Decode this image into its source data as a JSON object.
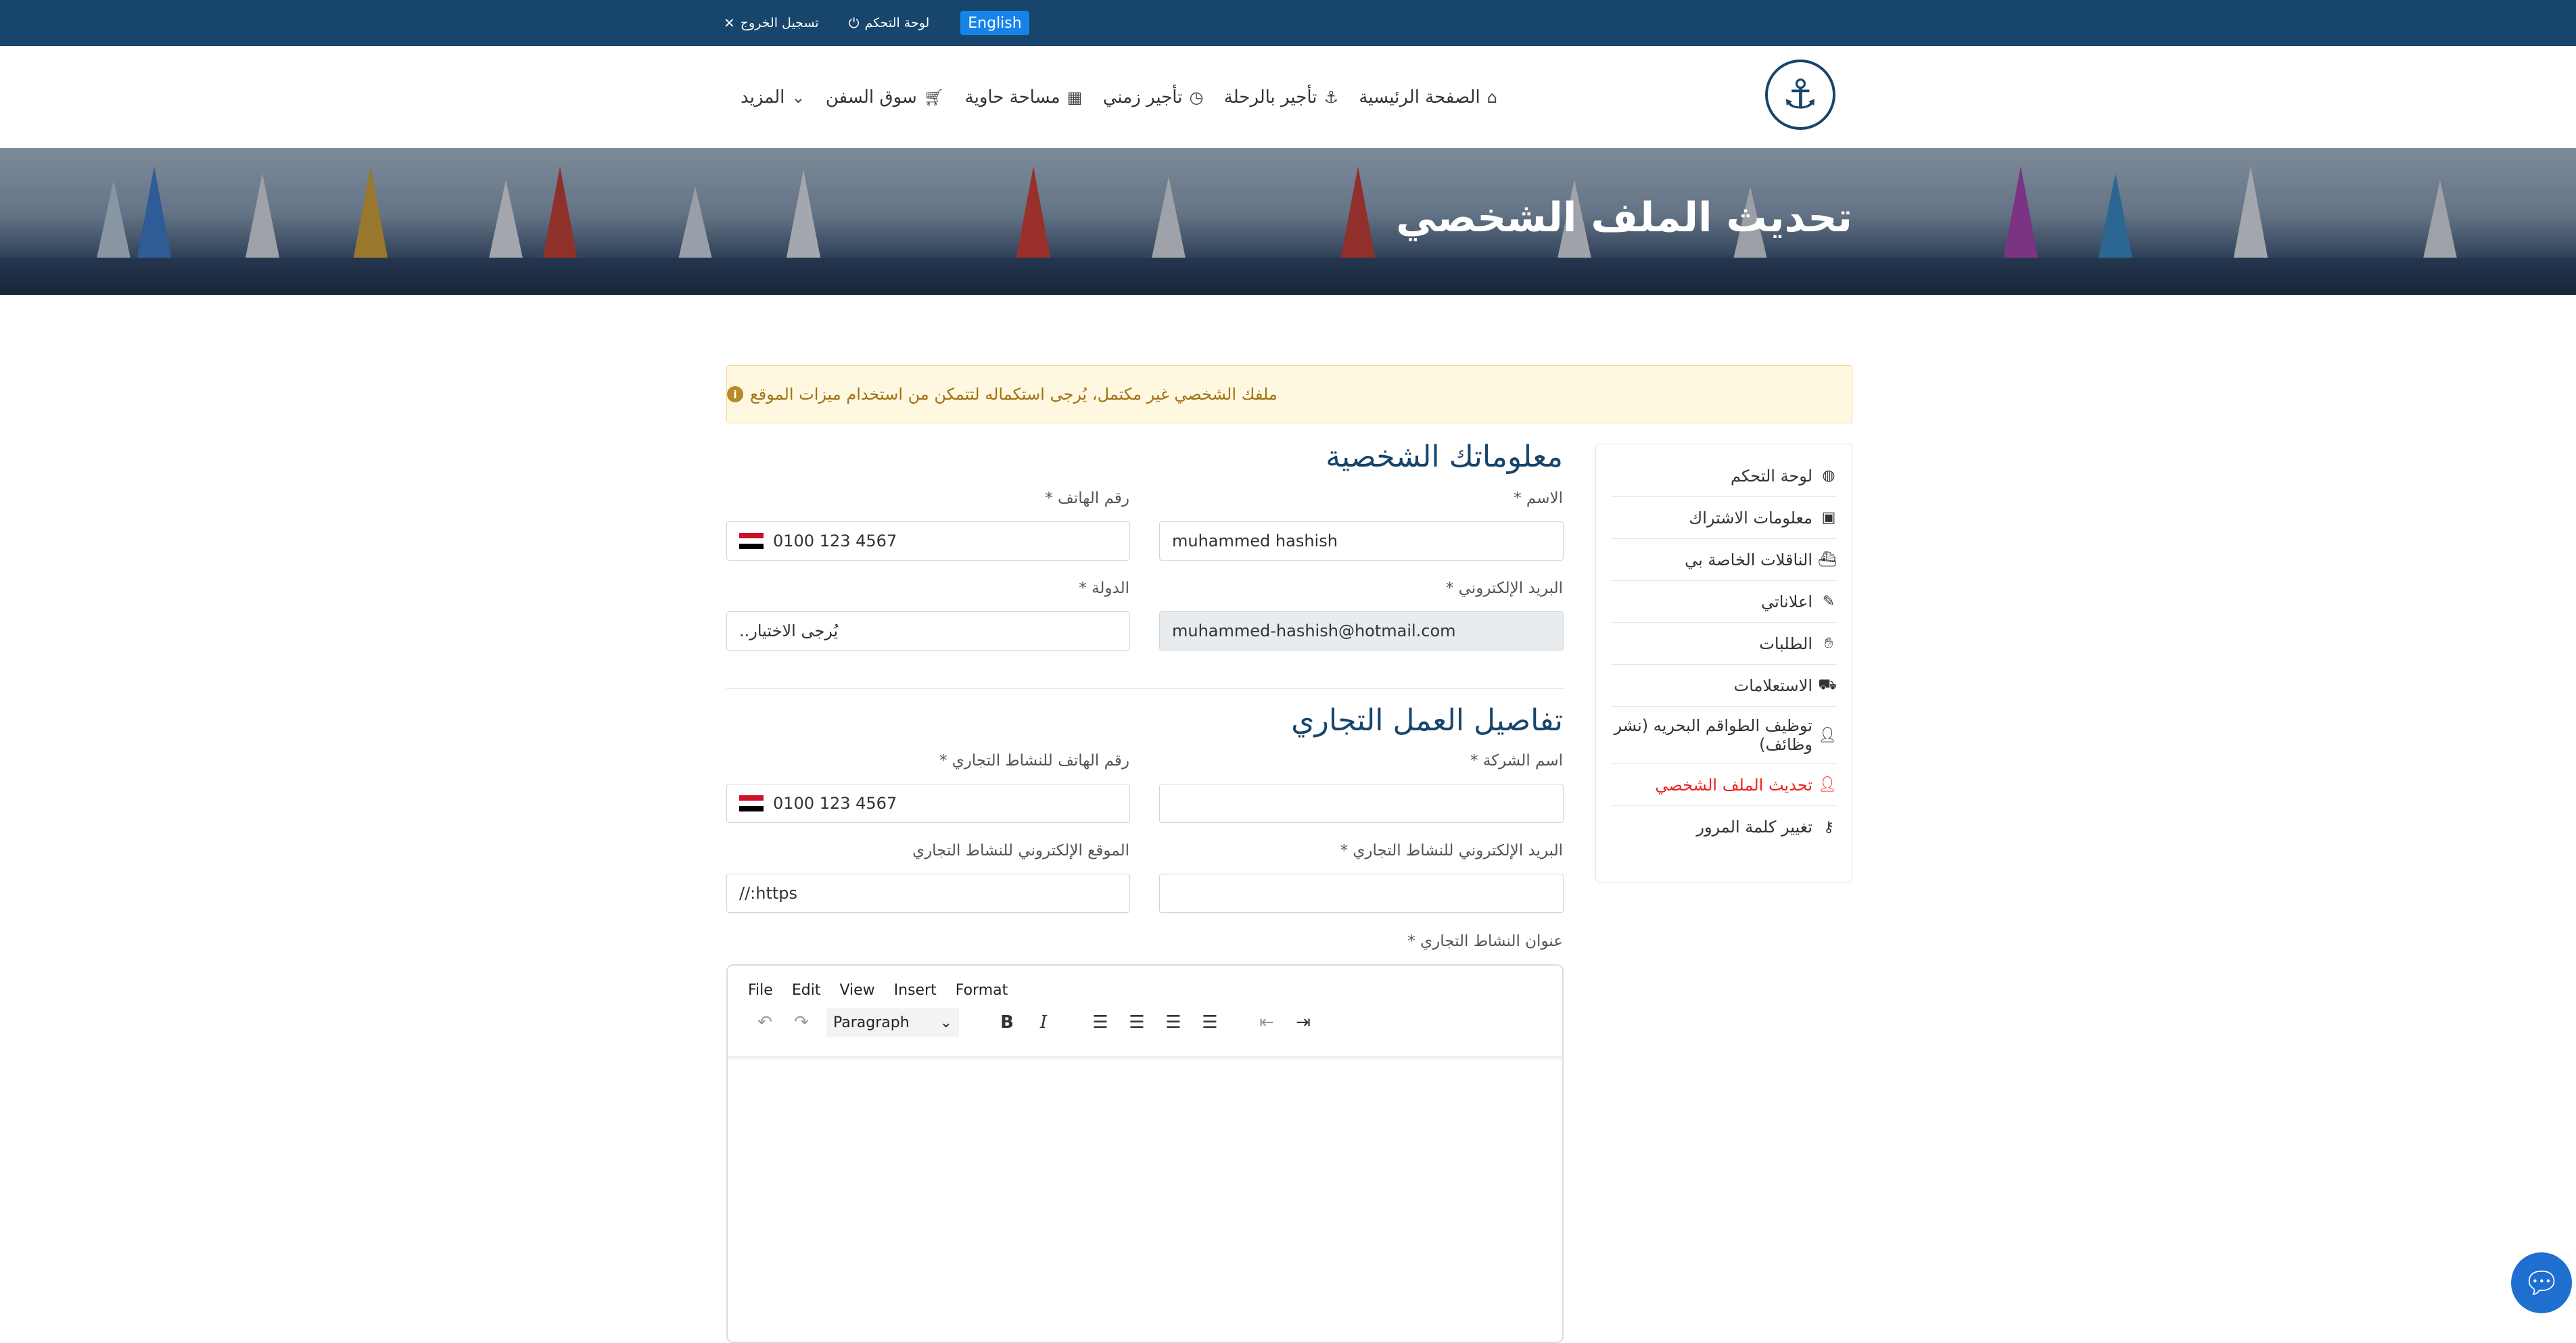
{
  "topbar": {
    "language_button": "English",
    "dashboard_link": "لوحة التحكم",
    "logout_link": "تسجيل الخروج"
  },
  "nav": {
    "home": "الصفحة الرئيسية",
    "trip_charter": "تأجير بالرحلة",
    "time_charter": "تأجير زمني",
    "container_space": "مساحة حاوية",
    "ship_market": "سوق السفن",
    "more": "المزيد"
  },
  "hero": {
    "title": "تحديث الملف الشخصي"
  },
  "alert": {
    "message": "ملفك الشخصي غير مكتمل، يُرجى استكماله لتتمكن من استخدام ميزات الموقع"
  },
  "sidebar": {
    "items": [
      {
        "label": "لوحة التحكم",
        "icon": "gauge-icon"
      },
      {
        "label": "معلومات الاشتراك",
        "icon": "calendar-check-icon"
      },
      {
        "label": "الناقلات الخاصة بي",
        "icon": "ship-icon"
      },
      {
        "label": "اعلاناتي",
        "icon": "megaphone-icon"
      },
      {
        "label": "الطلبات",
        "icon": "hand-icon"
      },
      {
        "label": "الاستعلامات",
        "icon": "inquiries-icon"
      },
      {
        "label": "توظيف الطواقم البحريه (نشر وظائف)",
        "icon": "user-tie-icon"
      },
      {
        "label": "تحديث الملف الشخصي",
        "icon": "user-icon",
        "active": true
      },
      {
        "label": "تغيير كلمة المرور",
        "icon": "key-icon"
      }
    ]
  },
  "personal": {
    "title": "معلوماتك الشخصية",
    "name_label": "الاسم *",
    "name_value": "muhammed hashish",
    "phone_label": "رقم الهاتف *",
    "phone_value": "0100 123 4567",
    "email_label": "البريد الإلكتروني *",
    "email_value": "muhammed-hashish@hotmail.com",
    "country_label": "الدولة *",
    "country_value": "يُرجى الاختيار.."
  },
  "business": {
    "title": "تفاصيل العمل التجاري",
    "company_label": "اسم الشركة *",
    "company_value": "",
    "business_phone_label": "رقم الهاتف للنشاط التجاري *",
    "business_phone_value": "0100 123 4567",
    "business_email_label": "البريد الإلكتروني للنشاط التجاري *",
    "business_email_value": "",
    "website_label": "الموقع الإلكتروني للنشاط التجاري",
    "website_value": "https://",
    "address_label": "عنوان النشاط التجاري *"
  },
  "editor": {
    "menus": [
      "File",
      "Edit",
      "View",
      "Insert",
      "Format"
    ],
    "block_format": "Paragraph"
  },
  "colors": {
    "topbar": "#17456b",
    "accent": "#1783e9",
    "active_sidebar": "#e22222",
    "alert_bg": "#fff8e1"
  }
}
